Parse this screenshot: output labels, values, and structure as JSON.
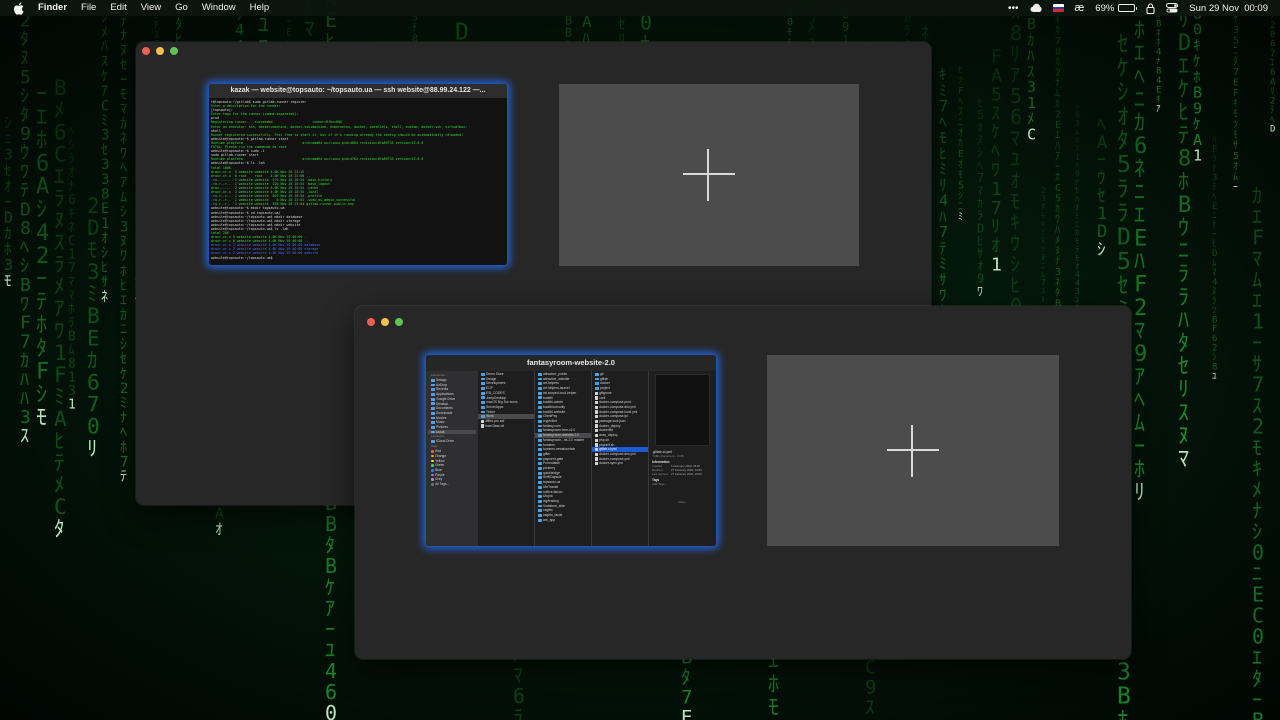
{
  "menubar": {
    "app_name": "Finder",
    "menus": [
      "File",
      "Edit",
      "View",
      "Go",
      "Window",
      "Help"
    ],
    "battery_percent": "69%",
    "battery_level": 0.69,
    "datetime": "Sun 29 Nov  00:09",
    "input_source_symbol": "æ",
    "status_icons": [
      "more-icon",
      "creative-cloud-icon",
      "russian-flag-icon",
      "keyboard-input-icon",
      "battery-icon",
      "lock-icon",
      "control-center-icon"
    ]
  },
  "colors": {
    "matrix_green": "#21c43a",
    "selection_glow": "#206eff",
    "finder_selection": "#1c5bd1"
  },
  "spaces": [
    {
      "window_title": "kazak — website@topsauto: ~/topsauto.ua — ssh website@88.99.24.122 —...",
      "terminal_lines": [
        {
          "c": "w",
          "t": "t@topsauto:~/gitlab$ sudo gitlab-runner register"
        },
        {
          "c": "g",
          "t": "Enter a description for the runner:"
        },
        {
          "c": "w",
          "t": "[topsauto]:"
        },
        {
          "c": "g",
          "t": "Enter tags for the runner (comma-separated):"
        },
        {
          "c": "w",
          "t": "prod"
        },
        {
          "c": "g",
          "t": "Registering runner... succeeded                    runner=RfbzcHQG"
        },
        {
          "c": "g",
          "t": "Enter an executor: ssh, docker+machine, docker-ssh+machine, kubernetes, docker, parallels, shell, custom, docker-ssh, virtualbox:"
        },
        {
          "c": "w",
          "t": "shell"
        },
        {
          "c": "g",
          "t": "Runner registered successfully. Feel free to start it, but if it's running already the config should be automatically reloaded!"
        },
        {
          "c": "w",
          "t": "website@topsauto:~$ gitlab-runner start"
        },
        {
          "c": "g",
          "t": "Runtime platform                              arch=amd64 os=linux pid=4804 revision=8fa89735 version=13.6.0"
        },
        {
          "c": "g",
          "t": "FATAL: Please run the commands as root"
        },
        {
          "c": "w",
          "t": "website@topsauto:~$ sudo -i"
        },
        {
          "c": "w",
          "t": "sudo gitlab-runner start"
        },
        {
          "c": "g",
          "t": "Runtime platform                              arch=amd64 os=linux pid=4762 revision=8fa89735 version=13.6.0"
        },
        {
          "c": "w",
          "t": "website@topsauto:~$ ls -lah"
        },
        {
          "c": "g",
          "t": "total 160K"
        },
        {
          "c": "g",
          "t": "drwxr-xr-x  5 website website 4.0K Nov 28 23:15 ."
        },
        {
          "c": "g",
          "t": "drwxr-xr-x  6 root    root    4.0K Nov 28 22:00 .."
        },
        {
          "c": "g",
          "t": "-rw-------  1 website website  575 Nov 28 18:54 .bash_history"
        },
        {
          "c": "g",
          "t": "-rw-r--r--  1 website website  220 Nov 28 18:54 .bash_logout"
        },
        {
          "c": "g",
          "t": "drwx------  2 website website 4.0K Nov 28 18:54 .cache"
        },
        {
          "c": "g",
          "t": "drwxr-xr-x  3 website website 4.0K Nov 28 18:55 .local"
        },
        {
          "c": "g",
          "t": "-rw-r--r--  1 website website  807 Nov 28 18:54 .profile"
        },
        {
          "c": "g",
          "t": "-rw-r--r--  1 website website    0 Nov 28 23:01 .sudo_as_admin_successful"
        },
        {
          "c": "g",
          "t": "-rw-r--r--  1 website website  558 Nov 28 23:04 gitlab-runner.public.key"
        },
        {
          "c": "w",
          "t": "website@topsauto:~$ mkdir topsauto.ua"
        },
        {
          "c": "w",
          "t": "website@topsauto:~$ cd topsauto.ua/"
        },
        {
          "c": "w",
          "t": "website@topsauto:~/topsauto.ua$ mkdir database"
        },
        {
          "c": "w",
          "t": "website@topsauto:~/topsauto.ua$ mkdir storage"
        },
        {
          "c": "w",
          "t": "website@topsauto:~/topsauto.ua$ mkdir website"
        },
        {
          "c": "w",
          "t": "website@topsauto:~/topsauto.ua$ ls -lah"
        },
        {
          "c": "g",
          "t": "total 20K"
        },
        {
          "c": "g",
          "t": "drwxr-xr-x 5 website website 4.0K Nov 29 00:09 ."
        },
        {
          "c": "g",
          "t": "drwxr-xr-x 6 website website 4.0K Nov 29 00:08 .."
        },
        {
          "c": "b",
          "t": "drwxr-xr-x 2 website website 4.0K Nov 29 00:09 database"
        },
        {
          "c": "b",
          "t": "drwxr-xr-x 2 website website 4.0K Nov 29 00:09 storage"
        },
        {
          "c": "b",
          "t": "drwxr-xr-x 2 website website 4.0K Nov 29 00:09 website"
        },
        {
          "c": "w",
          "t": "website@topsauto:~/topsauto.ua$ "
        }
      ]
    },
    {
      "window_title": "fantasyroom-website-2.0",
      "sidebar": {
        "favourites_heading": "Favourites",
        "items": [
          "Setapp",
          "AirDrop",
          "Recents",
          "Applications",
          "Google Drive",
          "Desktop",
          "Documents",
          "Downloads",
          "Movies",
          "Music",
          "Pictures",
          "kazak"
        ],
        "locations_heading": "Locations",
        "locations": [
          "iCloud Drive"
        ],
        "tags_heading": "Tags",
        "tags": [
          {
            "label": "Red",
            "color": "#ff5b51"
          },
          {
            "label": "Orange",
            "color": "#ff9f0a"
          },
          {
            "label": "Yellow",
            "color": "#ffd60a"
          },
          {
            "label": "Green",
            "color": "#32d74b"
          },
          {
            "label": "Blue",
            "color": "#0a84ff"
          },
          {
            "label": "Purple",
            "color": "#bf5af2"
          },
          {
            "label": "Grey",
            "color": "#98989d"
          },
          {
            "label": "All Tags...",
            "color": "#6e6e6e"
          }
        ]
      },
      "col1": [
        "Demo Store",
        "Design",
        "Development",
        "ECP",
        "ESl_CODES",
        "JumpDesktop",
        "macOS Big Sur Icons",
        "ServerApps",
        "Tinker",
        "Work",
        "diffeo-pro.sdf",
        "fuseGlass.txt"
      ],
      "col2": [
        "attractive_points",
        "attractive_website",
        "art-helpers",
        "art-helpers-laravel",
        "art-scoped-crud-helper",
        "buddhi",
        "buddhi-admin",
        "buddhiconsulty",
        "buddhi-website",
        "ClientPay",
        "cryptoBot",
        "fantasy.com",
        "fantasyroom-free-v2.0",
        "fantasyroom-website-2.0",
        "fantasyroom...rts 2.0 master",
        "fundees",
        "fundees-newsfountain",
        "gifter",
        "payment-gate",
        "Promotable",
        "porkerry",
        "quickbridge",
        "ShiftCapsule",
        "topsauto.ua",
        "UkrTransit",
        "unitive-falcon",
        "Utopia",
        "vigiltrading",
        "Vodafone_side",
        "vagitto",
        "vagitto_facial",
        "ww_app"
      ],
      "col3": [
        "git",
        "gitlab",
        "docker",
        "project",
        "gitignore",
        "conf",
        "docker-compose.prod",
        "docker-compose.dev.yml",
        "docker-compose.local.yml",
        "docker-compose.lpl",
        "package-lock.json",
        "docker_deploy",
        "dockerfile",
        "ansy_deploy",
        "php.sh",
        "phpunit.sh",
        "gitlab-ci.yml",
        "docker-compose.dev.yml",
        "docker-compose.yml",
        "docker-sync.yml"
      ],
      "preview": {
        "file_name": ".gitlab-ci.yml",
        "file_kind": "YAML Document - 3 KB",
        "info_heading": "Information",
        "info": [
          {
            "k": "Created",
            "v": "6 February 2020, 18:26"
          },
          {
            "k": "Modified",
            "v": "27 February 2020, 19:09"
          },
          {
            "k": "Last opened",
            "v": "27 February 2020, 19:09"
          }
        ],
        "tags_heading": "Tags",
        "tags_placeholder": "Add Tags...",
        "more_label": "More..."
      }
    }
  ]
}
